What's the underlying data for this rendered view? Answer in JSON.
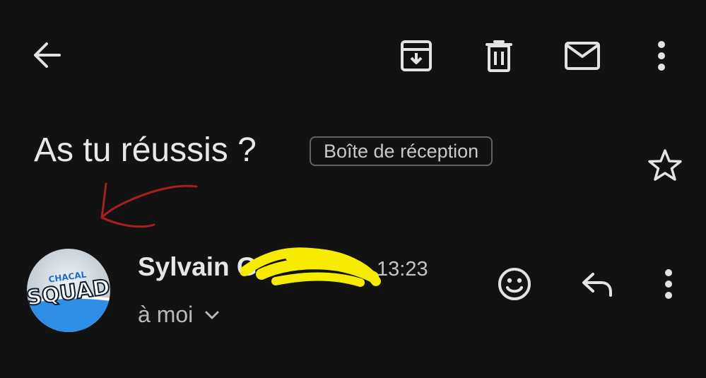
{
  "toolbar": {
    "back_icon": "arrow-back-icon",
    "archive_icon": "archive-icon",
    "delete_icon": "trash-icon",
    "mark_unread_icon": "mail-icon",
    "more_icon": "more-vert-icon"
  },
  "email": {
    "subject": "As tu réussis ?",
    "label": "Boîte de réception",
    "star_icon": "star-outline-icon"
  },
  "message": {
    "sender_name": "Sylvain G",
    "time": "13:23",
    "recipient": "à moi",
    "avatar_text_top": "CHACAL",
    "avatar_text_main": "SQUAD",
    "emoji_icon": "emoji-reaction-icon",
    "reply_icon": "reply-icon",
    "more_icon": "more-vert-icon"
  },
  "colors": {
    "background": "#121212",
    "text_primary": "#e8e8e8",
    "text_secondary": "#b9b9b9",
    "chip_border": "#5f6368",
    "annotation_red": "#a81f1f",
    "scribble_yellow": "#f7ec00",
    "avatar_blue": "#2f8fe6"
  }
}
